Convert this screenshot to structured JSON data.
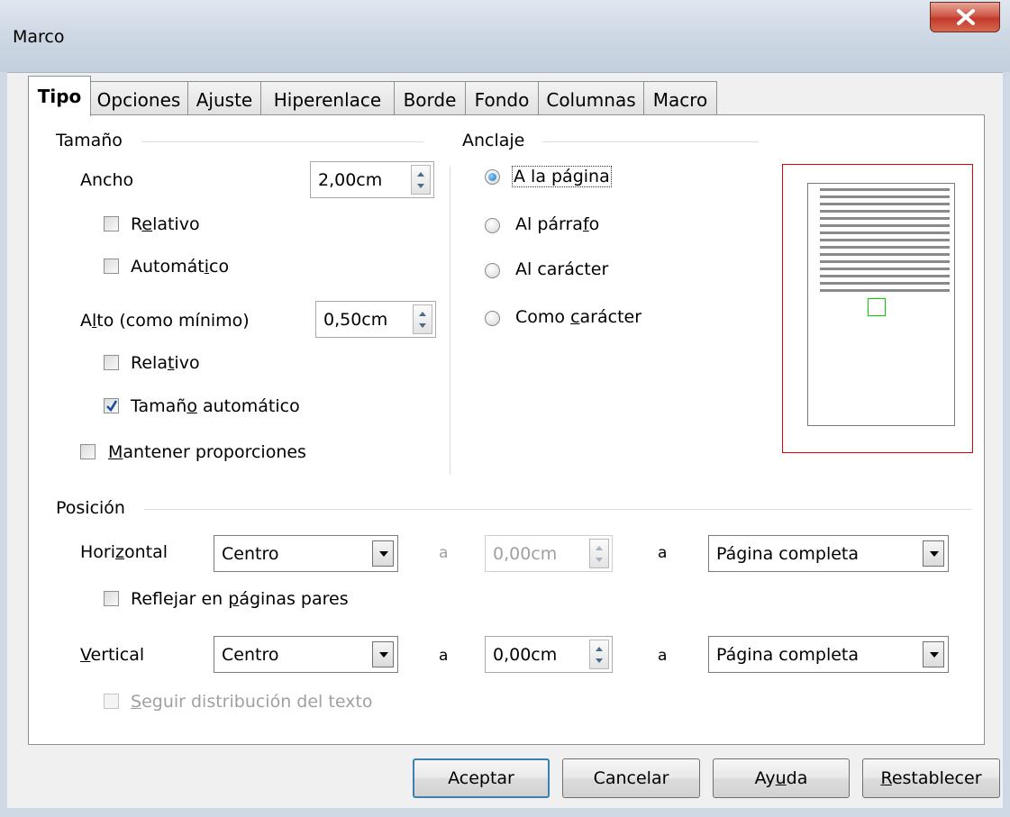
{
  "window": {
    "title": "Marco"
  },
  "tabs": [
    {
      "label": "Tipo",
      "active": true
    },
    {
      "label": "Opciones"
    },
    {
      "label": "Ajuste"
    },
    {
      "label": "Hiperenlace"
    },
    {
      "label": "Borde"
    },
    {
      "label": "Fondo"
    },
    {
      "label": "Columnas"
    },
    {
      "label": "Macro"
    }
  ],
  "size": {
    "section_title": "Tamaño",
    "width_label": "Ancho",
    "width_value": "2,00cm",
    "width_relative": {
      "label_pre": "R",
      "label_u": "e",
      "label_post": "lativo",
      "checked": false
    },
    "width_auto": {
      "label_pre": "Automát",
      "label_u": "i",
      "label_post": "co",
      "checked": false
    },
    "height_label_pre": "A",
    "height_label_u": "l",
    "height_label_post": "to (como mínimo)",
    "height_value": "0,50cm",
    "height_relative": {
      "label_pre": "Rela",
      "label_u": "t",
      "label_post": "ivo",
      "checked": false
    },
    "height_auto": {
      "label_pre": "Tamañ",
      "label_u": "o",
      "label_post": " automático",
      "checked": true
    },
    "keep_ratio": {
      "label_u": "M",
      "label_post": "antener proporciones",
      "checked": false
    }
  },
  "anchor": {
    "section_title": "Anclaje",
    "options": [
      {
        "label": "A la página",
        "selected": true
      },
      {
        "label_pre": "Al párra",
        "label_u": "f",
        "label_post": "o",
        "selected": false
      },
      {
        "label": "Al carácter",
        "selected": false
      },
      {
        "label_pre": "Como ",
        "label_u": "c",
        "label_post": "arácter",
        "selected": false
      }
    ]
  },
  "position": {
    "section_title": "Posición",
    "horizontal": {
      "label_pre": "Hori",
      "label_u": "z",
      "label_post": "ontal",
      "combo": "Centro",
      "a1": "a",
      "offset": "0,00cm",
      "a2": "a",
      "relative_to": "Página completa"
    },
    "mirror": {
      "label_pre": "Reflejar en ",
      "label_u": "p",
      "label_post": "áginas pares",
      "checked": false
    },
    "vertical": {
      "label_u": "V",
      "label_post": "ertical",
      "combo": "Centro",
      "a1": "a",
      "offset": "0,00cm",
      "a2": "a",
      "relative_to": "Página completa"
    },
    "follow_text": {
      "label_u": "S",
      "label_post": "eguir distribución del texto",
      "checked": false,
      "disabled": true
    }
  },
  "buttons": {
    "ok": "Aceptar",
    "cancel": "Cancelar",
    "help_pre": "Ay",
    "help_u": "u",
    "help_post": "da",
    "reset_u": "R",
    "reset_post": "establecer"
  },
  "icons": {
    "close": "close-icon",
    "checkmark": "checkmark-icon",
    "spin": "spin-arrows-icon",
    "dropdown": "chevron-down-icon"
  }
}
